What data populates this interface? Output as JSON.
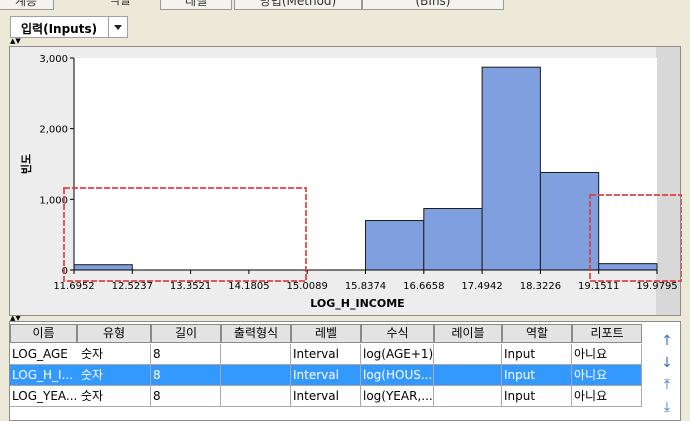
{
  "top_strip": {
    "cells": [
      {
        "label": "계층"
      },
      {
        "label": "역할"
      },
      {
        "label": "레벨"
      },
      {
        "label": "방법(Method)"
      },
      {
        "label": "(BIns)"
      }
    ]
  },
  "inputs_dropdown": {
    "label": "입력(Inputs)"
  },
  "chart_data": {
    "type": "bar",
    "xlabel": "LOG_H_INCOME",
    "ylabel": "빈도",
    "ylim": [
      0,
      3000
    ],
    "yticks": [
      "0",
      "1,000",
      "2,000",
      "3,000"
    ],
    "xticks": [
      "11.6952",
      "12.5237",
      "13.3521",
      "14.1805",
      "15.0089",
      "15.8374",
      "16.6658",
      "17.4942",
      "18.3226",
      "19.1511",
      "19.9795"
    ],
    "bins": [
      {
        "from": 11.6952,
        "to": 12.5237,
        "value": 75
      },
      {
        "from": 12.5237,
        "to": 13.3521,
        "value": 0
      },
      {
        "from": 13.3521,
        "to": 14.1805,
        "value": 0
      },
      {
        "from": 14.1805,
        "to": 15.0089,
        "value": 0
      },
      {
        "from": 15.0089,
        "to": 15.8374,
        "value": 0
      },
      {
        "from": 15.8374,
        "to": 16.6658,
        "value": 700
      },
      {
        "from": 16.6658,
        "to": 17.4942,
        "value": 870
      },
      {
        "from": 17.4942,
        "to": 18.3226,
        "value": 2870
      },
      {
        "from": 18.3226,
        "to": 19.1511,
        "value": 1380
      },
      {
        "from": 19.1511,
        "to": 19.9795,
        "value": 90
      }
    ],
    "bar_color": "#7f9fdf",
    "highlight_color": "#e23c3c",
    "grid": false
  },
  "table": {
    "headers": [
      "이름",
      "유형",
      "길이",
      "출력형식",
      "레벨",
      "수식",
      "레이블",
      "역할",
      "리포트"
    ],
    "rows": [
      [
        "LOG_AGE",
        "숫자",
        "8",
        "",
        "Interval",
        "log(AGE+1)",
        "",
        "Input",
        "아니요"
      ],
      [
        "LOG_H_I...",
        "숫자",
        "8",
        "",
        "Interval",
        "log(HOUS...",
        "",
        "Input",
        "아니요"
      ],
      [
        "LOG_YEA...",
        "숫자",
        "8",
        "",
        "Interval",
        "log(YEAR,...",
        "",
        "Input",
        "아니요"
      ]
    ],
    "selected_row": 1,
    "selection_color": "#3399ff"
  },
  "side_buttons": {
    "move_up": "↑",
    "move_down": "↓",
    "move_top": "⤒",
    "move_bottom": "⤓"
  }
}
